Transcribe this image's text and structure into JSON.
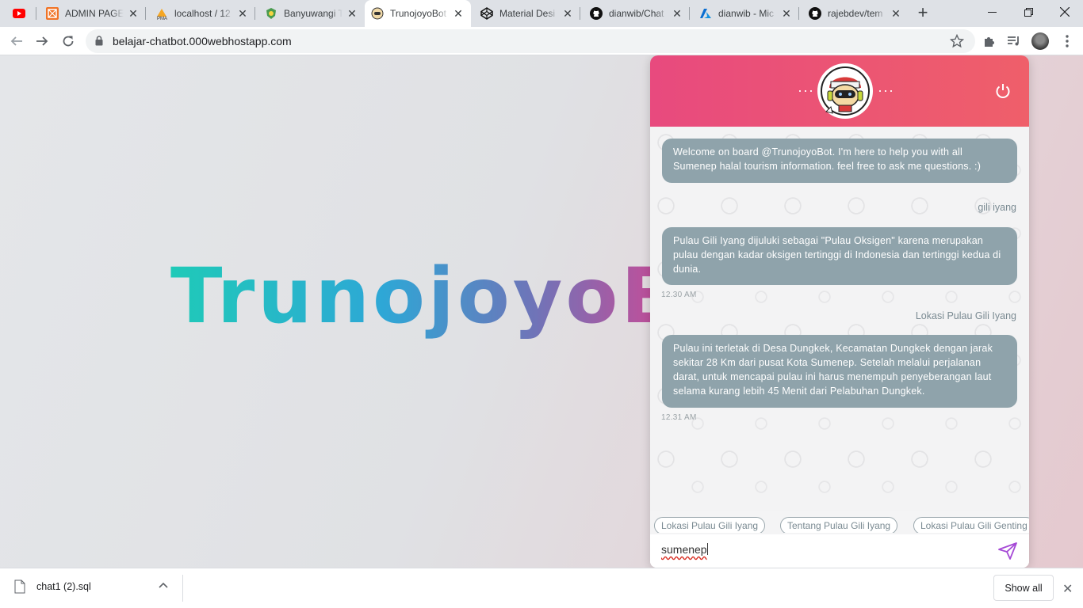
{
  "tabs": [
    {
      "label": "",
      "icon": "youtube-icon"
    },
    {
      "label": "ADMIN PAGE",
      "icon": "admin-icon"
    },
    {
      "label": "localhost / 12",
      "icon": "phpmyadmin-icon"
    },
    {
      "label": "Banyuwangi T",
      "icon": "banyuwangi-icon"
    },
    {
      "label": "TrunojoyoBot",
      "icon": "bot-icon"
    },
    {
      "label": "Material Desi",
      "icon": "codepen-icon"
    },
    {
      "label": "dianwib/Chat",
      "icon": "github-icon"
    },
    {
      "label": "dianwib - Mic",
      "icon": "azure-icon"
    },
    {
      "label": "rajebdev/tem",
      "icon": "github-icon"
    }
  ],
  "toolbar": {
    "url": "belajar-chatbot.000webhostapp.com"
  },
  "page": {
    "hero_text": "TrunojoyoBot"
  },
  "chat": {
    "header_dots_left": "···",
    "header_dots_right": "···",
    "messages": [
      {
        "from": "bot",
        "text": "Welcome on board @TrunojoyoBot. I'm here to help you with all Sumenep halal tourism information. feel free to ask me questions. :)",
        "time": ""
      },
      {
        "from": "user",
        "text": "gili iyang"
      },
      {
        "from": "bot",
        "text": "Pulau Gili Iyang dijuluki sebagai \"Pulau Oksigen\" karena merupakan pulau dengan kadar oksigen tertinggi di Indonesia dan tertinggi kedua di dunia.",
        "time": "12.30 AM"
      },
      {
        "from": "user",
        "text": "Lokasi Pulau Gili Iyang"
      },
      {
        "from": "bot",
        "text": "Pulau ini terletak di Desa Dungkek, Kecamatan Dungkek dengan jarak sekitar 28 Km dari pusat Kota Sumenep. Setelah melalui perjalanan darat, untuk mencapai pulau ini harus menempuh penyeberangan laut selama kurang lebih 45 Menit dari Pelabuhan Dungkek.",
        "time": "12.31 AM"
      }
    ],
    "suggestions": [
      "Lokasi Pulau Gili Iyang",
      "Tentang Pulau Gili Iyang",
      "Lokasi Pulau Gili Genting"
    ],
    "input_value": "sumenep"
  },
  "download": {
    "filename": "chat1 (2).sql",
    "show_all": "Show all"
  },
  "colors": {
    "header_start": "#e84a7e",
    "header_end": "#ef5f6a",
    "bubble": "#8fa3ab",
    "send": "#a64ad6"
  }
}
